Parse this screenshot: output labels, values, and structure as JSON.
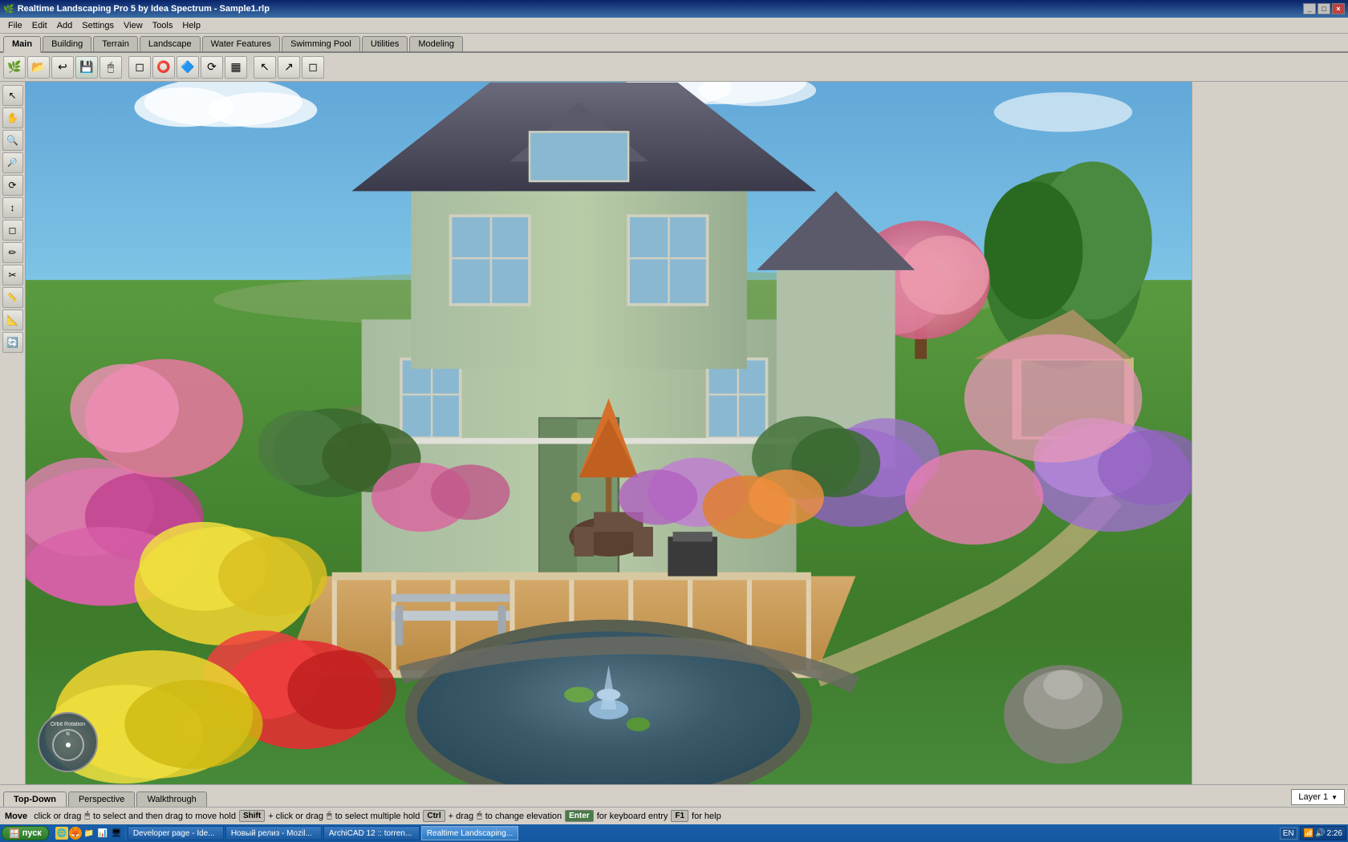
{
  "titlebar": {
    "title": "Realtime Landscaping Pro 5 by Idea Spectrum - Sample1.rlp",
    "icon": "🌿",
    "buttons": [
      "_",
      "□",
      "×"
    ]
  },
  "menubar": {
    "items": [
      "File",
      "Edit",
      "Add",
      "Settings",
      "View",
      "Tools",
      "Help"
    ]
  },
  "tabs": {
    "items": [
      "Main",
      "Building",
      "Terrain",
      "Landscape",
      "Water Features",
      "Swimming Pool",
      "Utilities",
      "Modeling"
    ],
    "active": "Main"
  },
  "toolbar": {
    "buttons": [
      "↩",
      "↺",
      "💾",
      "🖱",
      "⬜",
      "⭕",
      "🔷",
      "⟳",
      "⬛",
      "↖",
      "↗",
      "◻"
    ]
  },
  "left_tools": {
    "buttons": [
      "↖",
      "✋",
      "🔍",
      "🔍",
      "⟳",
      "↕",
      "◻",
      "✏",
      "✂",
      "⚡",
      "📐",
      "🔄"
    ]
  },
  "viewport_label": "Orbit   Rotation",
  "bottom_tabs": {
    "items": [
      "Top-Down",
      "Perspective",
      "Walkthrough"
    ],
    "active": "Top-Down"
  },
  "layer": {
    "label": "Layer 1",
    "dropdown_icon": "▼"
  },
  "statusbar": {
    "move_label": "Move",
    "instructions": [
      {
        "text": "click or drag",
        "icon": "🖱",
        "suffix": " to select and then drag to move"
      },
      {
        "text": " hold "
      },
      {
        "key": "Shift"
      },
      {
        "text": " + click or drag",
        "icon": "🖱"
      },
      {
        "text": " to select multiple  hold "
      },
      {
        "key": "Ctrl"
      },
      {
        "text": " + drag",
        "icon": "🖱"
      },
      {
        "text": " to change elevation  "
      },
      {
        "key": "Enter"
      },
      {
        "text": " for keyboard entry  "
      },
      {
        "key": "F1"
      },
      {
        "text": " for help"
      }
    ]
  },
  "taskbar": {
    "start_label": "пуск",
    "items": [
      {
        "label": "Developer page - Ide...",
        "active": false
      },
      {
        "label": "Новый релиз - Mozil...",
        "active": false
      },
      {
        "label": "ArchiCAD 12 :: torren...",
        "active": false
      },
      {
        "label": "Realtime Landscaping...",
        "active": true
      }
    ],
    "time": "2:26",
    "lang": "EN"
  }
}
